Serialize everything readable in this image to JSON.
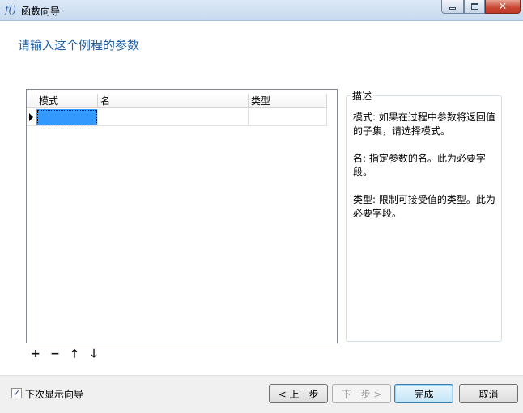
{
  "window": {
    "title": "函数向导",
    "icon_glyph": "f()",
    "controls": {
      "minimize": "—",
      "maximize": "□",
      "close": "✕"
    }
  },
  "heading": "请输入这个例程的参数",
  "grid": {
    "columns": [
      "模式",
      "名",
      "类型"
    ],
    "rows": [
      {
        "mode": "",
        "name": "",
        "type": ""
      }
    ]
  },
  "toolbar": {
    "add": "+",
    "remove": "−",
    "up": "🡑",
    "down": "🡓"
  },
  "description": {
    "title": "描述",
    "mode_text": "模式: 如果在过程中参数将返回值的子集，请选择模式。",
    "name_text": "名: 指定参数的名。此为必要字段。",
    "type_text": "类型: 限制可接受值的类型。此为必要字段。"
  },
  "footer": {
    "show_next_time_label": "下次显示向导",
    "show_next_time_checked": true,
    "check_mark": "✓",
    "prev_label": "< 上一步",
    "next_label": "下一步 >",
    "finish_label": "完成",
    "cancel_label": "取消"
  }
}
